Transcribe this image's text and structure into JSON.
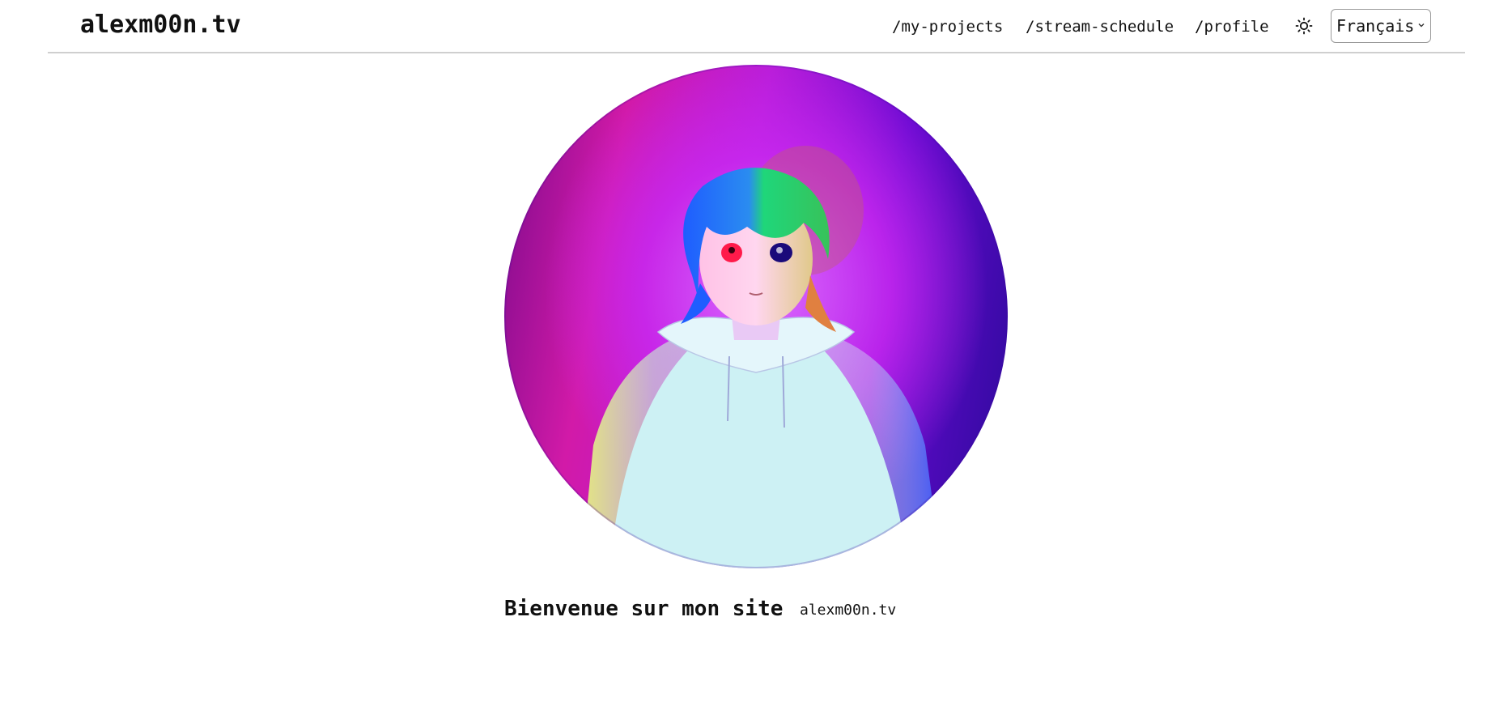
{
  "header": {
    "site_title": "alexm00n.tv",
    "nav": [
      {
        "label": "/my-projects"
      },
      {
        "label": "/stream-schedule"
      },
      {
        "label": "/profile"
      }
    ],
    "theme_toggle_icon": "sun-icon",
    "language_select": {
      "value": "Français",
      "chevron_icon": "chevron-down-icon"
    }
  },
  "hero": {
    "avatar_icon": "avatar-illustration",
    "welcome_text": "Bienvenue sur mon site",
    "handle": "alexm00n.tv"
  },
  "colors": {
    "text": "#111111",
    "divider": "#cfcfcf",
    "avatar_magenta": "#d21aa8",
    "avatar_purple": "#6a0ad2",
    "avatar_indigo": "#2b0a9a",
    "hoodie": "#cdf1f4"
  }
}
